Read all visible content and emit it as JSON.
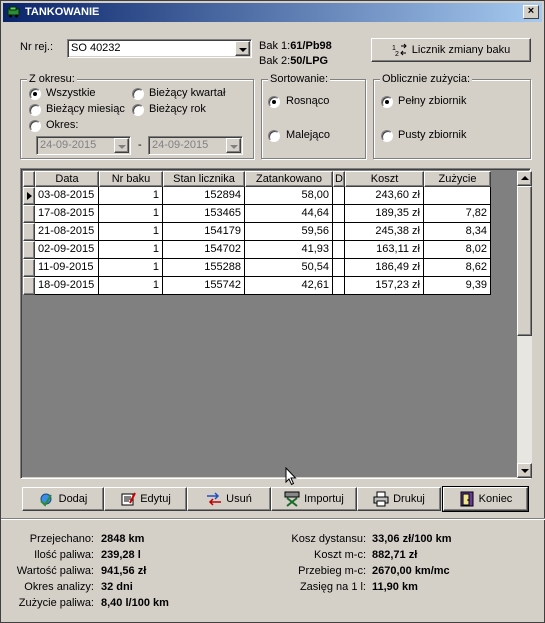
{
  "window": {
    "title": "TANKOWANIE",
    "close_glyph": "×"
  },
  "vehicle": {
    "label": "Nr rej.:",
    "value": "SO 40232",
    "tank1_label": "Bak 1:",
    "tank1_value": "61/Pb98",
    "tank2_label": "Bak 2:",
    "tank2_value": "50/LPG"
  },
  "meter_button": {
    "label": "Licznik zmiany baku",
    "icon": "meter-icon"
  },
  "period": {
    "title": "Z okresu:",
    "options": [
      {
        "label": "Wszystkie",
        "selected": true
      },
      {
        "label": "Bieżący kwartał",
        "selected": false
      },
      {
        "label": "Bieżący miesiąc",
        "selected": false
      },
      {
        "label": "Bieżący rok",
        "selected": false
      },
      {
        "label": "Okres:",
        "selected": false
      }
    ],
    "date_from": "24-09-2015",
    "date_separator": "-",
    "date_to": "24-09-2015"
  },
  "sort": {
    "title": "Sortowanie:",
    "options": [
      {
        "label": "Rosnąco",
        "selected": true
      },
      {
        "label": "Malejąco",
        "selected": false
      }
    ]
  },
  "consumption": {
    "title": "Oblicznie zużycia:",
    "options": [
      {
        "label": "Pełny zbiornik",
        "selected": true
      },
      {
        "label": "Pusty zbiornik",
        "selected": false
      }
    ]
  },
  "table": {
    "columns": [
      "Data",
      "Nr baku",
      "Stan licznika",
      "Zatankowano",
      "D",
      "Koszt",
      "Zużycie"
    ],
    "rows": [
      [
        "03-08-2015",
        "1",
        "152894",
        "58,00",
        "",
        "243,60 zł",
        ""
      ],
      [
        "17-08-2015",
        "1",
        "153465",
        "44,64",
        "",
        "189,35 zł",
        "7,82"
      ],
      [
        "21-08-2015",
        "1",
        "154179",
        "59,56",
        "",
        "245,38 zł",
        "8,34"
      ],
      [
        "02-09-2015",
        "1",
        "154702",
        "41,93",
        "",
        "163,11 zł",
        "8,02"
      ],
      [
        "11-09-2015",
        "1",
        "155288",
        "50,54",
        "",
        "186,49 zł",
        "8,62"
      ],
      [
        "18-09-2015",
        "1",
        "155742",
        "42,61",
        "",
        "157,23 zł",
        "9,39"
      ]
    ],
    "current_row": 0
  },
  "buttons": [
    {
      "name": "add",
      "label": "Dodaj",
      "icon": "add-record-icon"
    },
    {
      "name": "edit",
      "label": "Edytuj",
      "icon": "edit-icon"
    },
    {
      "name": "delete",
      "label": "Usuń",
      "icon": "delete-icon"
    },
    {
      "name": "import",
      "label": "Importuj",
      "icon": "import-icon"
    },
    {
      "name": "print",
      "label": "Drukuj",
      "icon": "printer-icon"
    },
    {
      "name": "close",
      "label": "Koniec",
      "icon": "exit-door-icon"
    }
  ],
  "summary": {
    "left": [
      {
        "label": "Przejechano:",
        "value": "2848 km"
      },
      {
        "label": "Ilość paliwa:",
        "value": "239,28 l"
      },
      {
        "label": "Wartość paliwa:",
        "value": "941,56 zł"
      },
      {
        "label": "Okres analizy:",
        "value": "32 dni"
      },
      {
        "label": "Zużycie paliwa:",
        "value": "8,40 l/100 km"
      }
    ],
    "right": [
      {
        "label": "Kosz dystansu:",
        "value": "33,06 zł/100 km"
      },
      {
        "label": "Koszt m-c:",
        "value": "882,71 zł"
      },
      {
        "label": "Przebieg m-c:",
        "value": "2670,00 km/mc"
      },
      {
        "label": "Zasięg na 1 l:",
        "value": "11,90 km"
      }
    ]
  },
  "colors": {
    "title_start": "#0a246a",
    "title_end": "#a6caf0",
    "face": "#d4d0c8"
  }
}
